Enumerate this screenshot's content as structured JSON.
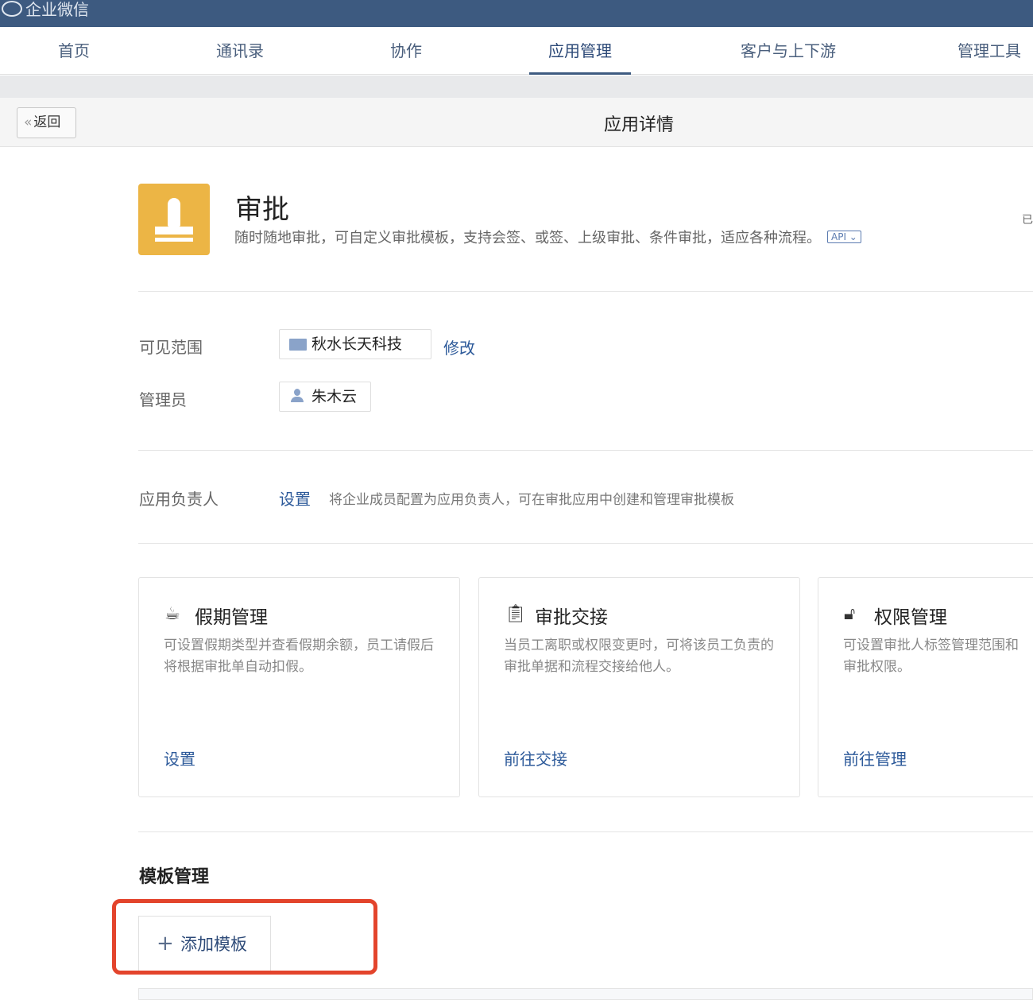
{
  "brand": "企业微信",
  "nav": [
    {
      "label": "首页"
    },
    {
      "label": "通讯录"
    },
    {
      "label": "协作"
    },
    {
      "label": "应用管理",
      "active": true
    },
    {
      "label": "客户与上下游"
    },
    {
      "label": "管理工具"
    }
  ],
  "subbar": {
    "back": "返回",
    "title": "应用详情"
  },
  "app": {
    "name": "审批",
    "description": "随时随地审批，可自定义审批模板，支持会签、或签、上级审批、条件审批，适应各种流程。",
    "api_badge": "API",
    "status_partial": "已",
    "icon_color": "#ecb545"
  },
  "visibility": {
    "label": "可见范围",
    "value": "秋水长天科技",
    "edit": "修改"
  },
  "admin": {
    "label": "管理员",
    "value": "朱木云"
  },
  "owner": {
    "label": "应用负责人",
    "action": "设置",
    "hint": "将企业成员配置为应用负责人，可在审批应用中创建和管理审批模板"
  },
  "cards": [
    {
      "icon": "cup-icon",
      "title": "假期管理",
      "desc": "可设置假期类型并查看假期余额，员工请假后将根据审批单自动扣假。",
      "action": "设置"
    },
    {
      "icon": "clipboard-icon",
      "title": "审批交接",
      "desc": "当员工离职或权限变更时，可将该员工负责的审批单据和流程交接给他人。",
      "action": "前往交接"
    },
    {
      "icon": "lock-icon",
      "title": "权限管理",
      "desc": "可设置审批人标签管理范围和审批权限。",
      "action": "前往管理"
    }
  ],
  "templates": {
    "title": "模板管理",
    "add": "添加模板"
  },
  "highlight_color": "#e3442c"
}
